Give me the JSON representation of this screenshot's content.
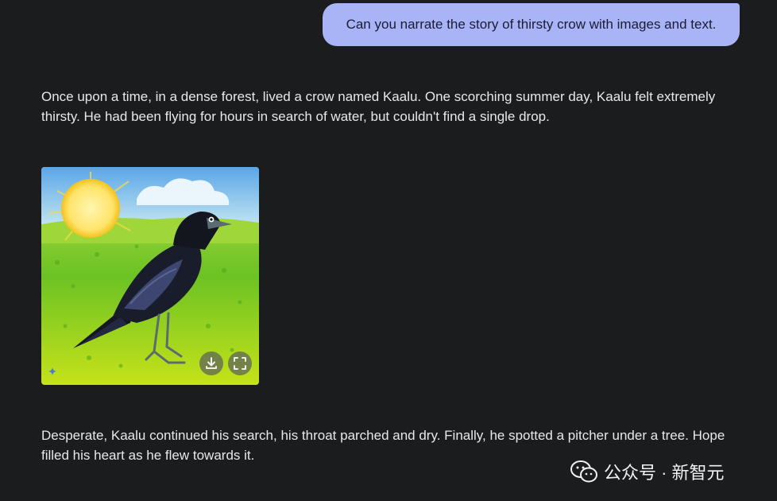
{
  "conversation": {
    "user_prompt": "Can you narrate the story of thirsty crow with images and text.",
    "response_paragraph_1": "Once upon a time, in a dense forest, lived a crow named Kaalu. One scorching summer day, Kaalu felt extremely thirsty. He had been flying for hours in search of water, but couldn't find a single drop.",
    "response_paragraph_2": "Desperate, Kaalu continued his search, his throat parched and dry. Finally, he spotted a pitcher under a tree. Hope filled his heart as he flew towards it."
  },
  "image_actions": {
    "download_icon": "download-icon",
    "fullscreen_icon": "fullscreen-icon",
    "generated_badge_icon": "sparkle-icon"
  },
  "watermark": {
    "text": "公众号 · 新智元",
    "icon": "wechat-icon"
  },
  "colors": {
    "background": "#1b1c1e",
    "user_bubble": "#a9b4f7",
    "text": "#e8e8e8"
  }
}
